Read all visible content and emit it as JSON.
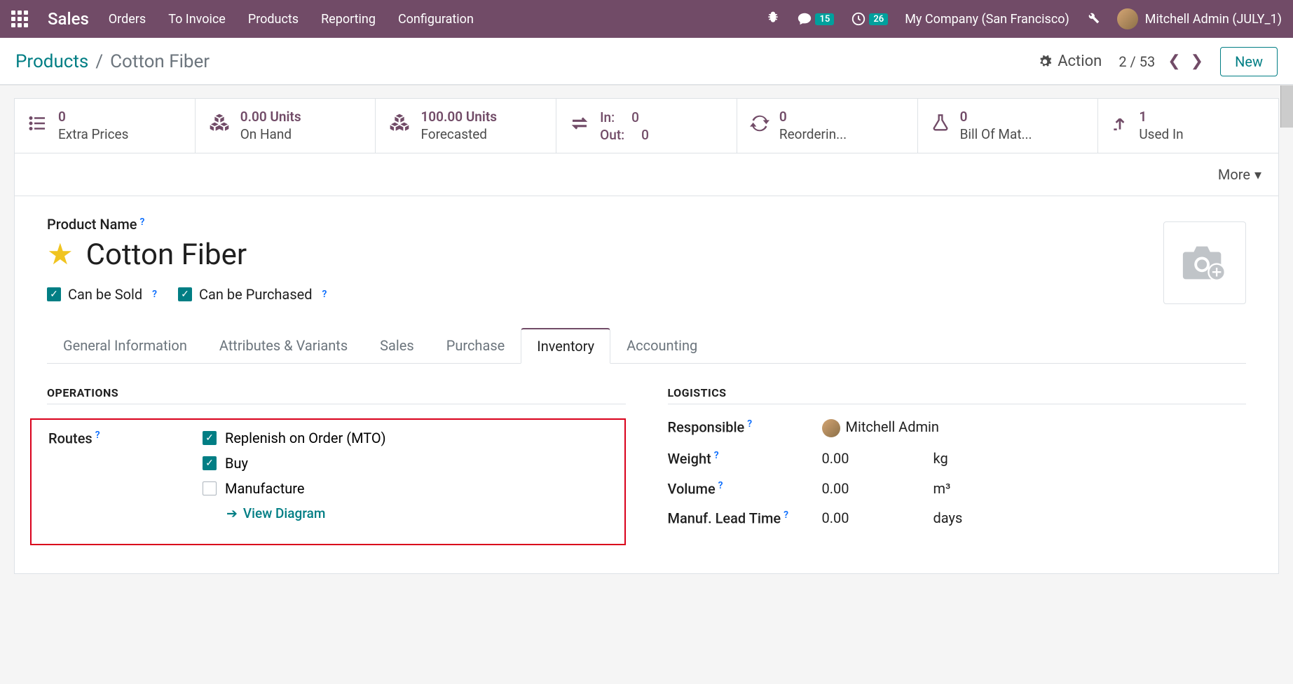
{
  "topbar": {
    "title": "Sales",
    "nav": [
      "Orders",
      "To Invoice",
      "Products",
      "Reporting",
      "Configuration"
    ],
    "messages_badge": "15",
    "activities_badge": "26",
    "company": "My Company (San Francisco)",
    "user": "Mitchell Admin (JULY_1)"
  },
  "control": {
    "breadcrumb_root": "Products",
    "breadcrumb_current": "Cotton Fiber",
    "action": "Action",
    "pager": "2 / 53",
    "new": "New"
  },
  "stats": {
    "extra_prices": {
      "value": "0",
      "label": "Extra Prices"
    },
    "on_hand": {
      "value": "0.00 Units",
      "label": "On Hand"
    },
    "forecasted": {
      "value": "100.00 Units",
      "label": "Forecasted"
    },
    "inout": {
      "in_label": "In:",
      "in_val": "0",
      "out_label": "Out:",
      "out_val": "0"
    },
    "reordering": {
      "value": "0",
      "label": "Reorderin..."
    },
    "bom": {
      "value": "0",
      "label": "Bill Of Mat..."
    },
    "used_in": {
      "value": "1",
      "label": "Used In"
    }
  },
  "more": "More",
  "product": {
    "name_label": "Product Name",
    "name": "Cotton Fiber",
    "can_be_sold": "Can be Sold",
    "can_be_purchased": "Can be Purchased"
  },
  "tabs": [
    "General Information",
    "Attributes & Variants",
    "Sales",
    "Purchase",
    "Inventory",
    "Accounting"
  ],
  "inventory": {
    "operations_title": "OPERATIONS",
    "routes_label": "Routes",
    "routes": {
      "mto": "Replenish on Order (MTO)",
      "buy": "Buy",
      "manufacture": "Manufacture"
    },
    "view_diagram": "View Diagram",
    "logistics_title": "LOGISTICS",
    "responsible_label": "Responsible",
    "responsible_value": "Mitchell Admin",
    "weight_label": "Weight",
    "weight_value": "0.00",
    "weight_unit": "kg",
    "volume_label": "Volume",
    "volume_value": "0.00",
    "volume_unit": "m³",
    "lead_label": "Manuf. Lead Time",
    "lead_value": "0.00",
    "lead_unit": "days"
  }
}
